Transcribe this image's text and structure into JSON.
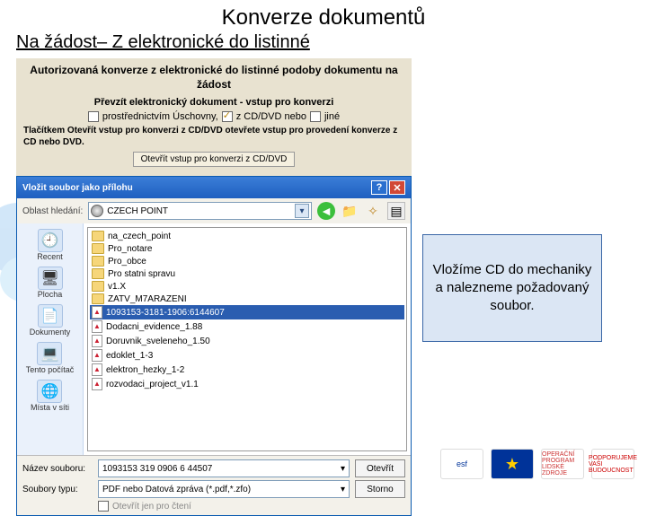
{
  "page": {
    "title": "Konverze dokumentů",
    "subtitle": "Na žádost– Z elektronické do listinné"
  },
  "conv": {
    "title": "Autorizovaná konverze z elektronické do listinné podoby dokumentu na žádost",
    "sub": "Převzít elektronický dokument - vstup pro konverzi",
    "chk1": "prostřednictvím Úschovny,",
    "chk2": "z CD/DVD nebo",
    "chk3": "jiné",
    "hint": "Tlačítkem Otevřít vstup pro konverzi z CD/DVD otevřete vstup pro provedení konverze z CD nebo DVD.",
    "btn": "Otevřít vstup pro konverzi z CD/DVD"
  },
  "dialog": {
    "title": "Vložit soubor jako přílohu",
    "look_label": "Oblast hledání:",
    "look_value": "CZECH POINT",
    "sidebar": [
      {
        "label": "Recent"
      },
      {
        "label": "Plocha"
      },
      {
        "label": "Dokumenty"
      },
      {
        "label": "Tento počítač"
      },
      {
        "label": "Místa v síti"
      }
    ],
    "files": [
      {
        "name": "na_czech_point",
        "type": "folder"
      },
      {
        "name": "Pro_notare",
        "type": "folder"
      },
      {
        "name": "Pro_obce",
        "type": "folder"
      },
      {
        "name": "Pro statni spravu",
        "type": "folder"
      },
      {
        "name": "v1.X",
        "type": "folder"
      },
      {
        "name": "ZATV_M7ARAZENI",
        "type": "folder"
      },
      {
        "name": "1093153-3181-1906:6144607",
        "type": "file",
        "selected": true
      },
      {
        "name": "Dodacni_evidence_1.88",
        "type": "file"
      },
      {
        "name": "Doruvnik_sveleneho_1.50",
        "type": "file"
      },
      {
        "name": "edoklet_1-3",
        "type": "file"
      },
      {
        "name": "elektron_hezky_1-2",
        "type": "file"
      },
      {
        "name": "rozvodaci_project_v1.1",
        "type": "file"
      }
    ],
    "filename_label": "Název souboru:",
    "filename_value": "1093153 319 0906 6 44507",
    "filetype_label": "Soubory typu:",
    "filetype_value": "PDF nebo Datová zpráva (*.pdf,*.zfo)",
    "open_btn": "Otevřít",
    "cancel_btn": "Storno",
    "readonly": "Otevřít jen pro čtení"
  },
  "callout": {
    "text": "Vložíme CD do mechaniky a nalezneme požadovaný soubor."
  },
  "footer": {
    "esf": "esf",
    "eu": "★",
    "op": "OPERAČNÍ PROGRAM LIDSKÉ ZDROJE",
    "pod": "PODPORUJEME VAŠI BUDOUCNOST"
  }
}
